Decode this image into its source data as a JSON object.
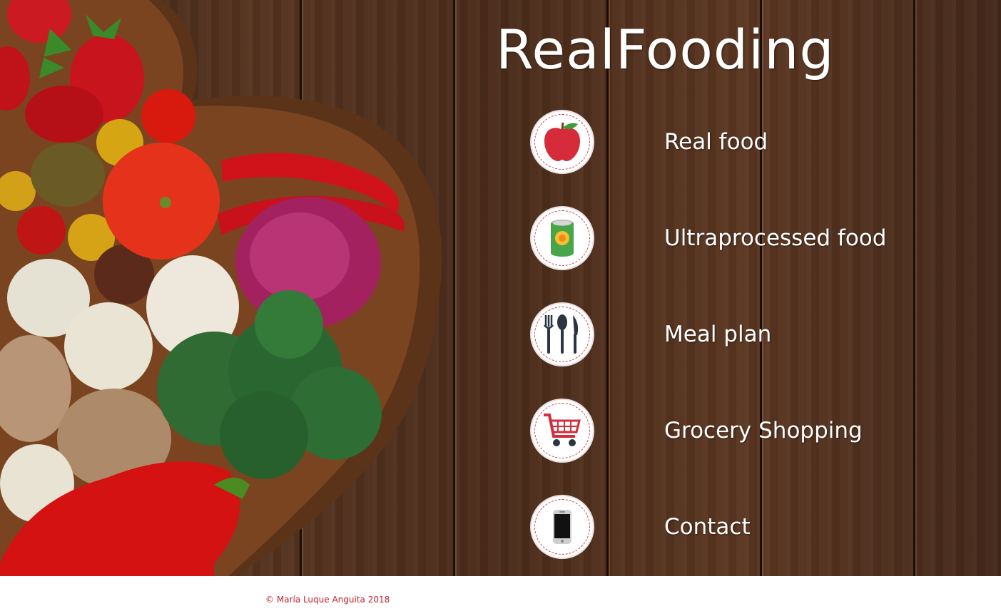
{
  "header": {
    "title": "RealFooding"
  },
  "nav": [
    {
      "label": "Real food",
      "icon": "apple-icon"
    },
    {
      "label": "Ultraprocessed food",
      "icon": "canned-food-icon"
    },
    {
      "label": "Meal plan",
      "icon": "cutlery-icon"
    },
    {
      "label": "Grocery Shopping",
      "icon": "shopping-cart-icon"
    },
    {
      "label": "Contact",
      "icon": "smartphone-icon"
    }
  ],
  "footer": {
    "copyright": "© María Luque Anguita 2018"
  },
  "colors": {
    "accent": "#d63b4a",
    "wood": "#4a2c1c",
    "text": "#ffffff"
  }
}
